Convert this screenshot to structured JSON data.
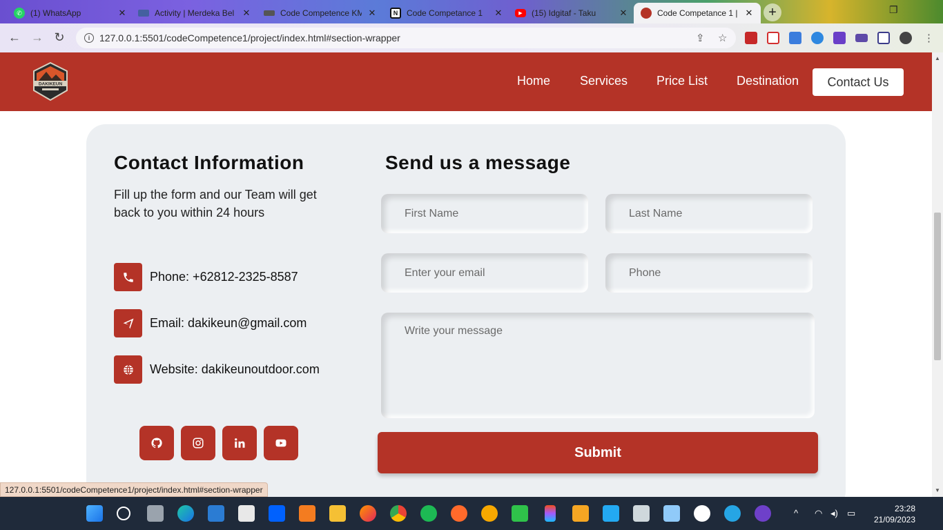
{
  "browser": {
    "tabs": [
      {
        "title": "(1) WhatsApp",
        "icon": "whatsapp-icon",
        "color": "#25d366"
      },
      {
        "title": "Activity | Merdeka Bel",
        "icon": "merdeka-icon",
        "color": "#4460a0"
      },
      {
        "title": "Code Competence KM",
        "icon": "code-icon",
        "color": "#555555"
      },
      {
        "title": "Code Competance 1",
        "icon": "notion-icon",
        "color": "#111111"
      },
      {
        "title": "(15) Idgitaf - Taku",
        "icon": "youtube-icon",
        "color": "#ff0000"
      },
      {
        "title": "Code Competance 1 |",
        "icon": "site-icon",
        "color": "#b43327"
      }
    ],
    "url": "127.0.0.1:5501/codeCompetence1/project/index.html#section-wrapper",
    "status_url": "127.0.0.1:5501/codeCompetence1/project/index.html#section-wrapper"
  },
  "navbar": {
    "logo_text": "DAKIKEUN",
    "links": [
      "Home",
      "Services",
      "Price List",
      "Destination"
    ],
    "cta": "Contact Us",
    "bg": "#b43327"
  },
  "contact": {
    "title": "Contact Information",
    "desc": "Fill up the form and our Team will get back to you within 24 hours",
    "items": [
      {
        "icon": "phone-icon",
        "text": "Phone: +62812-2325-8587"
      },
      {
        "icon": "paper-plane-icon",
        "text": "Email: dakikeun@gmail.com"
      },
      {
        "icon": "globe-icon",
        "text": "Website: dakikeunoutdoor.com"
      }
    ],
    "socials": [
      "github-icon",
      "instagram-icon",
      "linkedin-icon",
      "youtube-icon"
    ]
  },
  "form": {
    "title": "Send us a message",
    "first_name": "First Name",
    "last_name": "Last Name",
    "email": "Enter your email",
    "phone": "Phone",
    "message": "Write your message",
    "submit": "Submit"
  },
  "taskbar": {
    "time": "23:28",
    "date": "21/09/2023"
  }
}
